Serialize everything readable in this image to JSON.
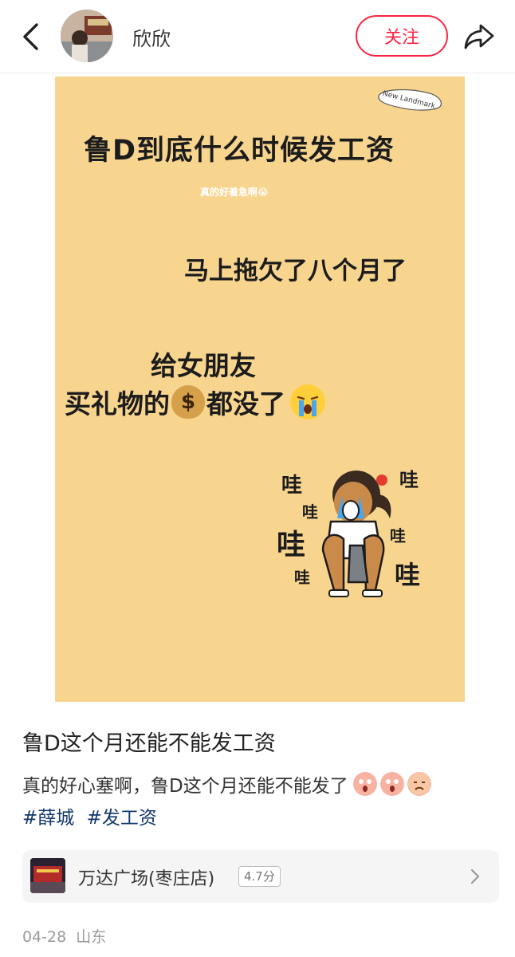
{
  "header": {
    "username": "欣欣",
    "follow_label": "关注"
  },
  "post_image": {
    "stamp_text": "New Landmark",
    "title": "鲁D到底什么时候发工资",
    "subtitle": "真的好着急啊😭",
    "line2": "马上拖欠了八个月了",
    "line3": "给女朋友",
    "line4_before": "买礼物的",
    "line4_after": "都没了",
    "wa_text": "哇"
  },
  "post": {
    "title": "鲁D这个月还能不能发工资",
    "body": "真的好心塞啊，鲁D这个月还能不能发了",
    "tags": [
      "#薛城",
      "#发工资"
    ]
  },
  "location": {
    "name": "万达广场(枣庄店)",
    "rating": "4.7分"
  },
  "meta": {
    "date": "04-28",
    "region": "山东"
  },
  "colors": {
    "accent": "#ff2442",
    "image_bg": "#f8d58f",
    "tag": "#13386c"
  }
}
